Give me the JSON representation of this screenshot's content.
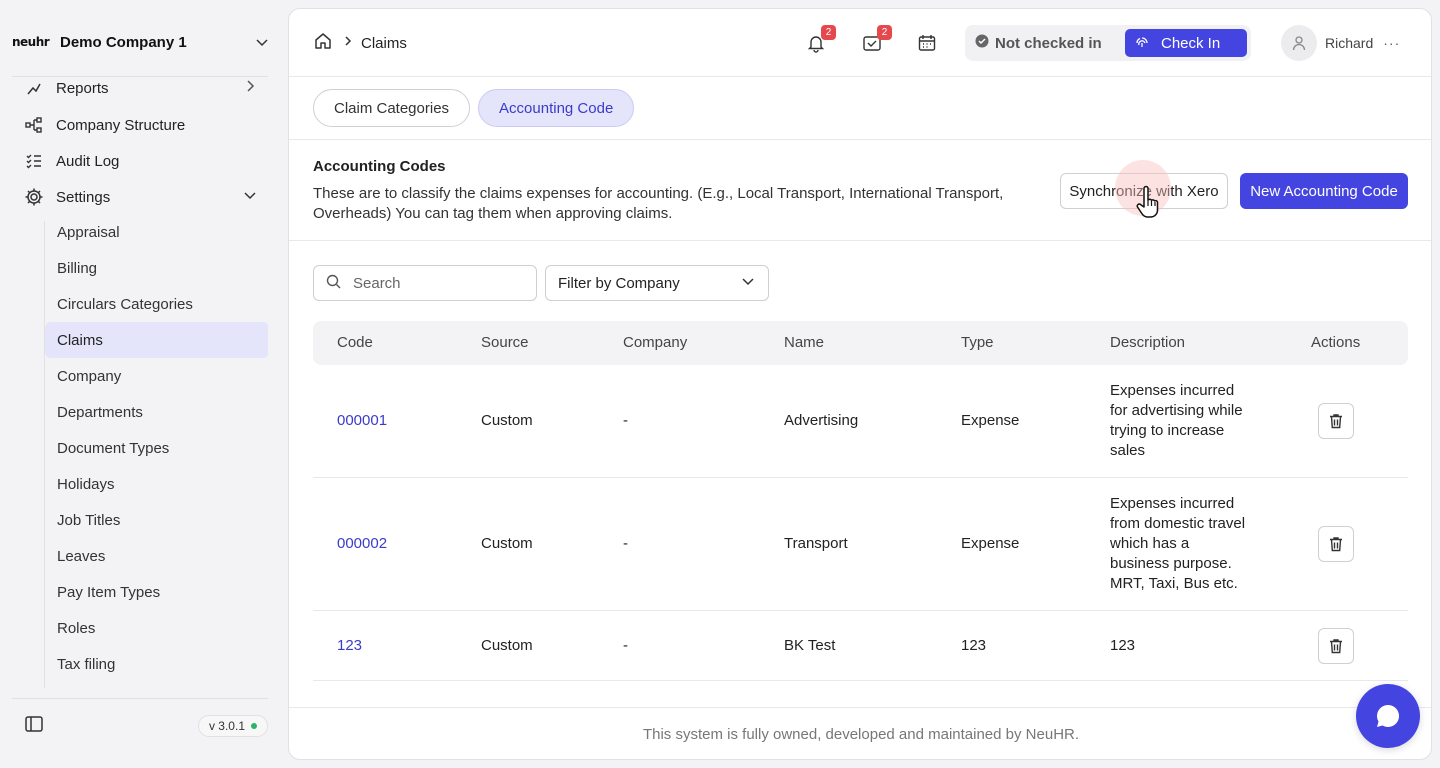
{
  "sidebar": {
    "logo": "neuhr",
    "company": "Demo Company 1",
    "items": [
      {
        "label": "Reports"
      },
      {
        "label": "Company Structure"
      },
      {
        "label": "Audit Log"
      },
      {
        "label": "Settings"
      }
    ],
    "settings_children": [
      "Appraisal",
      "Billing",
      "Circulars Categories",
      "Claims",
      "Company",
      "Departments",
      "Document Types",
      "Holidays",
      "Job Titles",
      "Leaves",
      "Pay Item Types",
      "Roles",
      "Tax filing"
    ],
    "active_child": "Claims",
    "version": "v 3.0.1"
  },
  "header": {
    "title": "Claims",
    "notifications_count": "2",
    "tasks_count": "2",
    "status": "Not checked in",
    "checkin_label": "Check In",
    "user_name": "Richard"
  },
  "tabs": [
    {
      "label": "Claim Categories",
      "active": false
    },
    {
      "label": "Accounting Code",
      "active": true
    }
  ],
  "section": {
    "title": "Accounting Codes",
    "description": "These are to classify the claims expenses for accounting. (E.g., Local Transport, International Transport, Overheads) You can tag them when approving claims.",
    "sync_label": "Synchronize with Xero",
    "new_label": "New Accounting Code"
  },
  "filters": {
    "search_placeholder": "Search",
    "company_filter": "Filter by Company"
  },
  "table": {
    "columns": [
      "Code",
      "Source",
      "Company",
      "Name",
      "Type",
      "Description",
      "Actions"
    ],
    "rows": [
      {
        "code": "000001",
        "source": "Custom",
        "company": "-",
        "name": "Advertising",
        "type": "Expense",
        "description": "Expenses incurred for advertising while trying to increase sales"
      },
      {
        "code": "000002",
        "source": "Custom",
        "company": "-",
        "name": "Transport",
        "type": "Expense",
        "description": "Expenses incurred from domestic travel which has a business purpose. MRT, Taxi, Bus etc."
      },
      {
        "code": "123",
        "source": "Custom",
        "company": "-",
        "name": "BK Test",
        "type": "123",
        "description": "123"
      }
    ]
  },
  "footer": {
    "text": "This system is fully owned, developed and maintained by NeuHR."
  },
  "colors": {
    "accent": "#4444e0",
    "active_bg": "#e4e5fb",
    "badge": "#e5484d"
  }
}
